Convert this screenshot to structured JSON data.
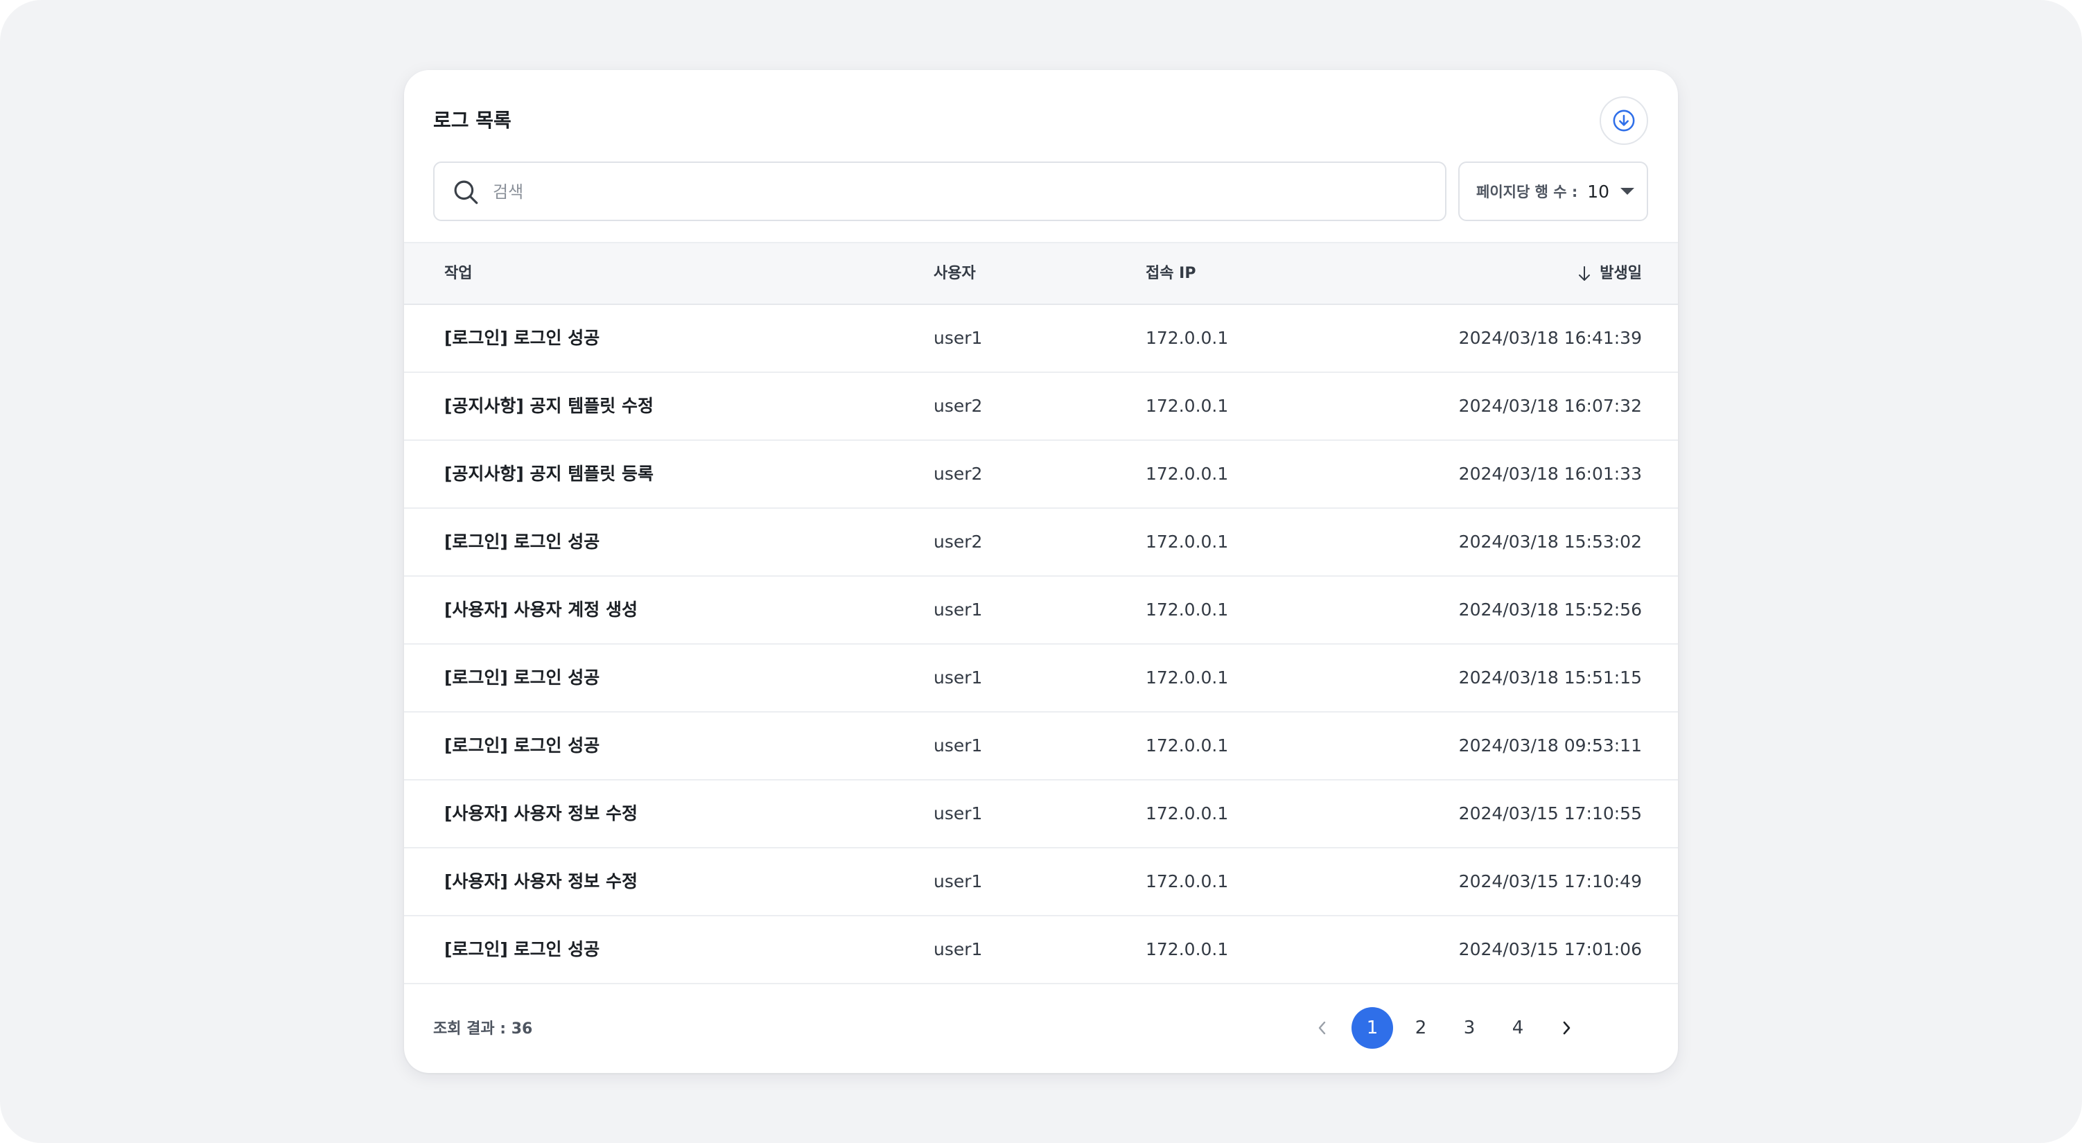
{
  "panel": {
    "title": "로그 목록",
    "download_icon": "download-circle-icon"
  },
  "search": {
    "placeholder": "검색",
    "value": ""
  },
  "rows_per_page": {
    "label": "페이지당 행 수 :",
    "value": "10"
  },
  "table": {
    "columns": {
      "task": "작업",
      "user": "사용자",
      "ip": "접속 IP",
      "date": "발생일"
    },
    "sort": {
      "column": "date",
      "direction": "desc",
      "icon": "arrow-down-icon"
    },
    "rows": [
      {
        "task": "[로그인] 로그인 성공",
        "user": "user1",
        "ip": "172.0.0.1",
        "date": "2024/03/18 16:41:39"
      },
      {
        "task": "[공지사항] 공지 템플릿 수정",
        "user": "user2",
        "ip": "172.0.0.1",
        "date": "2024/03/18 16:07:32"
      },
      {
        "task": "[공지사항] 공지 템플릿 등록",
        "user": "user2",
        "ip": "172.0.0.1",
        "date": "2024/03/18 16:01:33"
      },
      {
        "task": "[로그인] 로그인 성공",
        "user": "user2",
        "ip": "172.0.0.1",
        "date": "2024/03/18 15:53:02"
      },
      {
        "task": "[사용자] 사용자 계정 생성",
        "user": "user1",
        "ip": "172.0.0.1",
        "date": "2024/03/18 15:52:56"
      },
      {
        "task": "[로그인] 로그인 성공",
        "user": "user1",
        "ip": "172.0.0.1",
        "date": "2024/03/18 15:51:15"
      },
      {
        "task": "[로그인] 로그인 성공",
        "user": "user1",
        "ip": "172.0.0.1",
        "date": "2024/03/18 09:53:11"
      },
      {
        "task": "[사용자] 사용자 정보 수정",
        "user": "user1",
        "ip": "172.0.0.1",
        "date": "2024/03/15 17:10:55"
      },
      {
        "task": "[사용자] 사용자 정보 수정",
        "user": "user1",
        "ip": "172.0.0.1",
        "date": "2024/03/15 17:10:49"
      },
      {
        "task": "[로그인] 로그인 성공",
        "user": "user1",
        "ip": "172.0.0.1",
        "date": "2024/03/15 17:01:06"
      }
    ]
  },
  "footer": {
    "result_count": "조회 결과 : 36"
  },
  "pagination": {
    "pages": [
      "1",
      "2",
      "3",
      "4"
    ],
    "current": "1"
  },
  "colors": {
    "accent": "#2f6fe9",
    "background": "#f2f3f5",
    "header_row": "#f6f7f9"
  }
}
